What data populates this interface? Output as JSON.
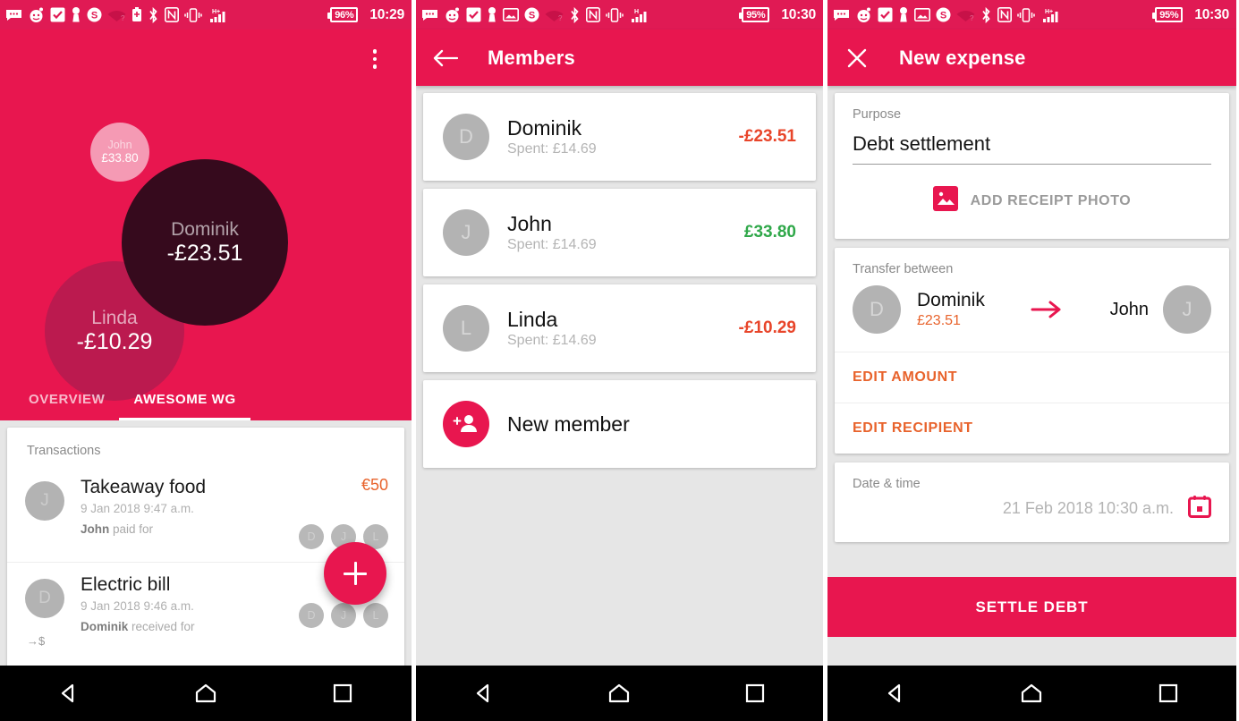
{
  "screen1": {
    "statusbar": {
      "battery": "96%",
      "time": "10:29",
      "icons": [
        "messages-icon",
        "reddit-icon",
        "tasks-icon",
        "pin-icon",
        "dollar-icon",
        "wifi-question-icon",
        "battery-saver-icon",
        "bluetooth-icon",
        "nfc-icon",
        "vibrate-icon",
        "signal-hplus-icon"
      ]
    },
    "menu_icon": "hamburger-menu-icon",
    "overflow_icon": "more-vertical-icon",
    "bubbles": [
      {
        "name": "John",
        "amount": "£33.80",
        "color": "#f59ab4"
      },
      {
        "name": "Linda",
        "amount": "-£10.29",
        "color": "#bb1a4f"
      },
      {
        "name": "Dominik",
        "amount": "-£23.51",
        "color": "#360a1d"
      }
    ],
    "tabs": [
      {
        "label": "OVERVIEW",
        "active": false
      },
      {
        "label": "AWESOME WG",
        "active": true
      }
    ],
    "transactions_header": "Transactions",
    "transactions": [
      {
        "initial": "J",
        "title": "Takeaway food",
        "date": "9 Jan 2018 9:47 a.m.",
        "who": "John",
        "action": " paid for",
        "amount": "€50",
        "chips": [
          "D",
          "J",
          "L"
        ]
      },
      {
        "initial": "D",
        "title": "Electric bill",
        "date": "9 Jan 2018 9:46 a.m.",
        "who": "Dominik",
        "action": " received for",
        "amount": "",
        "chips": [
          "D",
          "J",
          "L"
        ],
        "received_icon": "→$"
      }
    ],
    "fab": "add-expense-fab"
  },
  "screen2": {
    "statusbar": {
      "battery": "95%",
      "time": "10:30"
    },
    "back_icon": "back-arrow-icon",
    "title": "Members",
    "members": [
      {
        "initial": "D",
        "name": "Dominik",
        "spent": "Spent: £14.69",
        "balance": "-£23.51",
        "sign": "neg"
      },
      {
        "initial": "J",
        "name": "John",
        "spent": "Spent: £14.69",
        "balance": "£33.80",
        "sign": "pos"
      },
      {
        "initial": "L",
        "name": "Linda",
        "spent": "Spent: £14.69",
        "balance": "-£10.29",
        "sign": "neg"
      }
    ],
    "new_member_label": "New member",
    "new_member_icon": "person-add-icon"
  },
  "screen3": {
    "statusbar": {
      "battery": "95%",
      "time": "10:30"
    },
    "close_icon": "close-icon",
    "title": "New expense",
    "purpose_label": "Purpose",
    "purpose_value": "Debt settlement",
    "purpose_placeholder": "Purpose",
    "add_receipt_label": "ADD RECEIPT PHOTO",
    "add_receipt_icon": "image-icon",
    "transfer_label": "Transfer between",
    "transfer_from_initial": "D",
    "transfer_from_name": "Dominik",
    "transfer_amount": "£23.51",
    "transfer_arrow_icon": "arrow-right-icon",
    "transfer_to_name": "John",
    "transfer_to_initial": "J",
    "edit_amount_label": "EDIT AMOUNT",
    "edit_recipient_label": "EDIT RECIPIENT",
    "datetime_label": "Date & time",
    "datetime_value": "21 Feb 2018 10:30 a.m.",
    "calendar_icon": "calendar-icon",
    "settle_label": "SETTLE DEBT"
  },
  "navbar": {
    "back": "android-back-icon",
    "home": "android-home-icon",
    "recents": "android-recents-icon"
  },
  "colors": {
    "primary": "#e8164f",
    "statusbar": "#e01a54",
    "accent_orange": "#e8632c",
    "negative": "#e8452a",
    "positive": "#30a84a",
    "page_bg": "#e6e6e6"
  }
}
